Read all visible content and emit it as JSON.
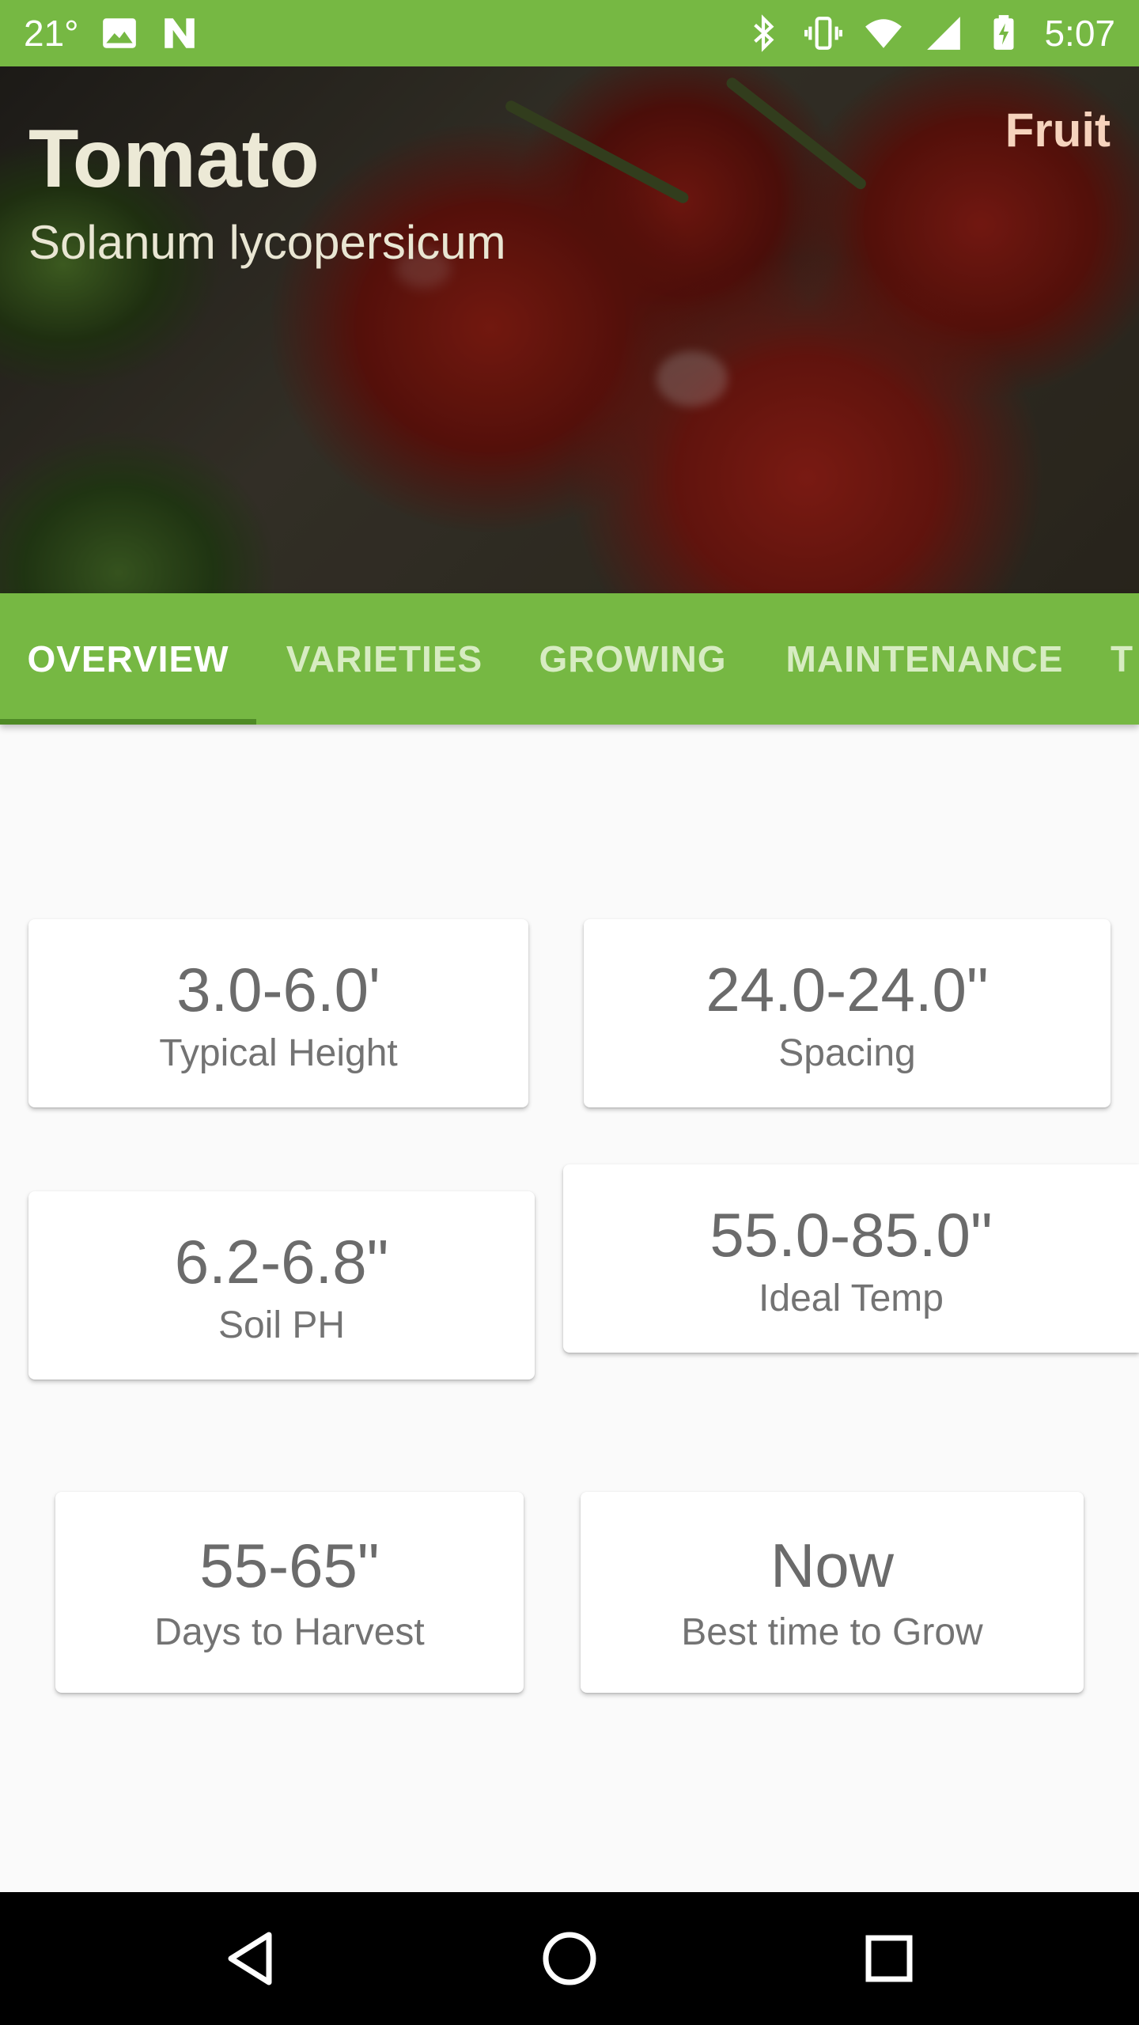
{
  "status_bar": {
    "temperature": "21°",
    "time": "5:07",
    "icons": [
      "image-icon",
      "n-logo-icon",
      "bluetooth-icon",
      "vibrate-icon",
      "wifi-icon",
      "signal-icon",
      "battery-charging-icon"
    ]
  },
  "plant": {
    "name": "Tomato",
    "scientific_name": "Solanum lycopersicum",
    "category": "Fruit"
  },
  "tabs": [
    {
      "label": "OVERVIEW",
      "active": true
    },
    {
      "label": "VARIETIES",
      "active": false
    },
    {
      "label": "GROWING",
      "active": false
    },
    {
      "label": "MAINTENANCE",
      "active": false
    },
    {
      "label": "T",
      "active": false
    }
  ],
  "cards": [
    {
      "value": "3.0-6.0'",
      "label": "Typical Height"
    },
    {
      "value": "24.0-24.0\"",
      "label": "Spacing"
    },
    {
      "value": "6.2-6.8\"",
      "label": "Soil PH"
    },
    {
      "value": "55.0-85.0\"",
      "label": "Ideal Temp"
    },
    {
      "value": "55-65\"",
      "label": "Days to Harvest"
    },
    {
      "value": "Now",
      "label": "Best time to Grow"
    }
  ],
  "nav_bar": {
    "buttons": [
      "back-icon",
      "home-icon",
      "recents-icon"
    ]
  },
  "colors": {
    "accent": "#76b843",
    "tab_indicator": "#4e8a25",
    "card_text": "#6b6b6b"
  }
}
